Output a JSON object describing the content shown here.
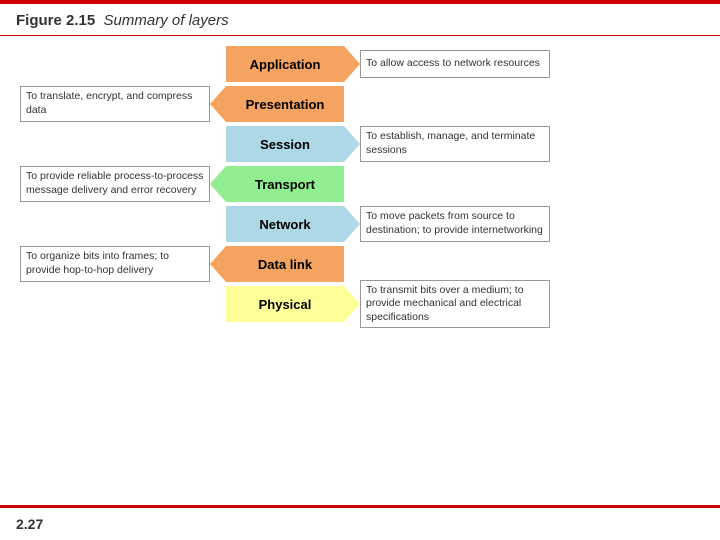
{
  "header": {
    "figure_label": "Figure 2.15",
    "figure_title": "Summary of layers"
  },
  "layers": [
    {
      "id": "application",
      "label": "Application",
      "color": "#f4a460",
      "left_desc": "",
      "right_desc": "To allow access to network resources",
      "has_left": false,
      "has_right": true
    },
    {
      "id": "presentation",
      "label": "Presentation",
      "color": "#f4a460",
      "left_desc": "To translate, encrypt, and compress data",
      "right_desc": "",
      "has_left": true,
      "has_right": false
    },
    {
      "id": "session",
      "label": "Session",
      "color": "#add8e6",
      "left_desc": "",
      "right_desc": "To establish, manage, and terminate sessions",
      "has_left": false,
      "has_right": true
    },
    {
      "id": "transport",
      "label": "Transport",
      "color": "#90ee90",
      "left_desc": "To provide reliable process-to-process message delivery and error recovery",
      "right_desc": "",
      "has_left": true,
      "has_right": false
    },
    {
      "id": "network",
      "label": "Network",
      "color": "#add8e6",
      "left_desc": "",
      "right_desc": "To move packets from source to destination; to provide internetworking",
      "has_left": false,
      "has_right": true
    },
    {
      "id": "datalink",
      "label": "Data link",
      "color": "#f4a460",
      "left_desc": "To organize bits into frames; to provide hop-to-hop delivery",
      "right_desc": "",
      "has_left": true,
      "has_right": false
    },
    {
      "id": "physical",
      "label": "Physical",
      "color": "#ffff99",
      "left_desc": "",
      "right_desc": "To transmit bits over a medium; to provide mechanical and electrical specifications",
      "has_left": false,
      "has_right": true
    }
  ],
  "footer": {
    "page_number": "2.27"
  }
}
